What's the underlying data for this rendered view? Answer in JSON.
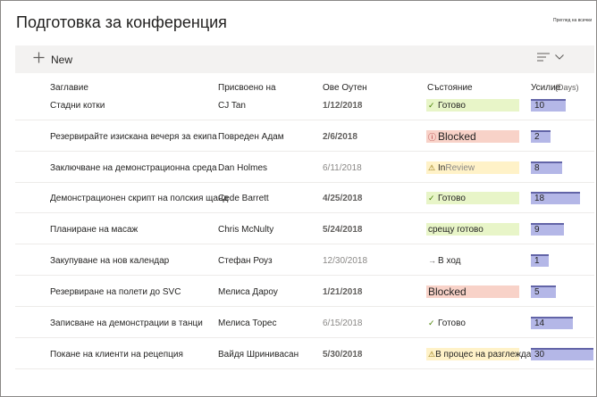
{
  "page": {
    "title": "Подготовка за конференция",
    "see_all": "Преглед на всички"
  },
  "toolbar": {
    "new_label": "New"
  },
  "columns": {
    "title": "Заглавие",
    "assigned": "Присвоено на",
    "due": "Ове Оутен",
    "status": "Състояние",
    "effort": "Усилие",
    "effort_unit": "(Days)"
  },
  "colors": {
    "effort_bar": "#b4b7e7",
    "effort_accent": "#6264a7",
    "status_done": "#e8f5c8",
    "status_blocked": "#f8d2c8",
    "status_review": "#fff2c8"
  },
  "rows": [
    {
      "title": "Стадни котки",
      "assigned": "CJ Tan",
      "due": "1/12/2018",
      "status": "Готово",
      "status_icon": "check-icon",
      "effort": "10",
      "effort_value": 10
    },
    {
      "title": "Резервирайте изискана вечеря за екипа",
      "assigned": "Повреден Адам",
      "due": "2/6/2018",
      "status": "Blocked",
      "status_icon": "blocked-icon",
      "effort": "2",
      "effort_value": 2
    },
    {
      "title": "Заключване на демонстрационна среда",
      "assigned": "Dan Holmes",
      "due": "6/11/2018",
      "status": "In",
      "status_suffix": "Review",
      "status_icon": "warning-icon",
      "effort": "8",
      "effort_value": 8
    },
    {
      "title": "Демонстрационен скрипт на полския щанд",
      "assigned": "Cede Barrett",
      "due": "4/25/2018",
      "status": "Готово",
      "status_icon": "check-icon",
      "effort": "18",
      "effort_value": 18
    },
    {
      "title": "Планиране на масаж",
      "assigned": "Chris McNulty",
      "due": "5/24/2018",
      "status": "срещу готово",
      "status_icon": "",
      "effort": "9",
      "effort_value": 9
    },
    {
      "title": "Закупуване на нов календар",
      "assigned": "Стефан Роуз",
      "due": "12/30/2018",
      "status": "В ход",
      "status_icon": "arrow-right-icon",
      "effort": "1",
      "effort_value": 1
    },
    {
      "title": "Резервиране на полети до SVC",
      "assigned": "Мелиса Дарoу",
      "due": "1/21/2018",
      "status": "Blocked",
      "status_icon": "",
      "effort": "5",
      "effort_value": 5
    },
    {
      "title": "Записване на демонстрации в танци",
      "assigned": "Мелиса Торес",
      "due": "6/15/2018",
      "status": "Готово",
      "status_icon": "check-icon",
      "effort": "14",
      "effort_value": 14
    },
    {
      "title": "Покане на клиенти на рецепция",
      "assigned": "Вайдя Шринивасан",
      "due": "5/30/2018",
      "status": "В процес на разглеждане",
      "status_icon": "warning-icon",
      "effort": "30",
      "effort_value": 30
    }
  ]
}
